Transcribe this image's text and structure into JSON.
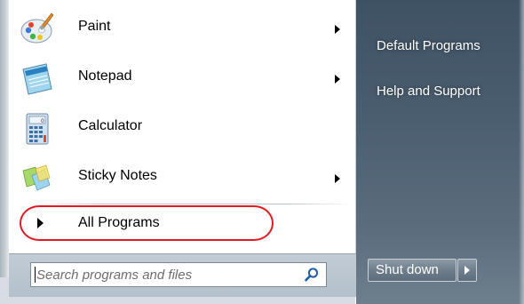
{
  "start_menu": {
    "programs": [
      {
        "label": "Paint",
        "icon": "paint-icon",
        "has_submenu": true
      },
      {
        "label": "Notepad",
        "icon": "notepad-icon",
        "has_submenu": true
      },
      {
        "label": "Calculator",
        "icon": "calculator-icon",
        "has_submenu": false
      },
      {
        "label": "Sticky Notes",
        "icon": "sticky-notes-icon",
        "has_submenu": true
      }
    ],
    "all_programs_label": "All Programs",
    "search": {
      "placeholder": "Search programs and files",
      "value": ""
    },
    "right_links": [
      {
        "label": "Default Programs"
      },
      {
        "label": "Help and Support"
      }
    ],
    "shutdown_label": "Shut down",
    "annotation_color": "#e21b22"
  }
}
